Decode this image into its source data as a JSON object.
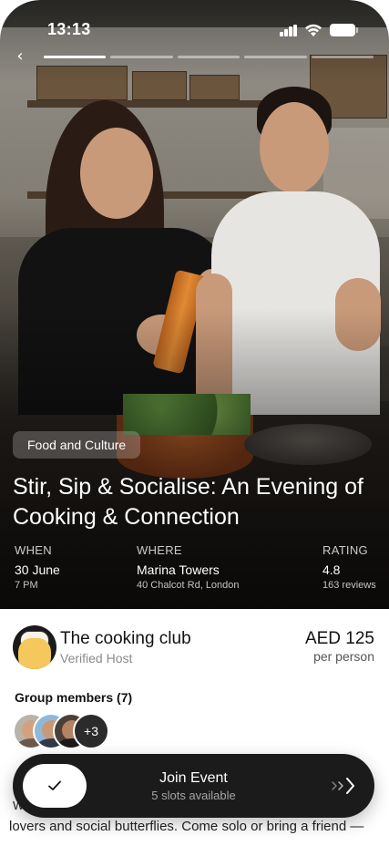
{
  "status_bar": {
    "time": "13:13"
  },
  "story": {
    "segments": 5,
    "active_segment": 1
  },
  "event": {
    "category": "Food and Culture",
    "title": "Stir, Sip & Socialise: An Evening of Cooking & Connection",
    "when": {
      "label": "WHEN",
      "value": "30 June",
      "sub": "7 PM"
    },
    "where": {
      "label": "WHERE",
      "value": "Marina Towers",
      "sub": "40 Chalcot Rd, London"
    },
    "rating": {
      "label": "RATING",
      "value": "4.8",
      "sub": "163 reviews"
    }
  },
  "host": {
    "name": "The cooking club",
    "subtitle": "Verified Host"
  },
  "price": {
    "amount": "AED 125",
    "unit": "per person"
  },
  "members": {
    "label": "Group members (7)",
    "more": "+3"
  },
  "description": {
    "partial_word": "W",
    "visible_line": "lovers and social butterflies. Come solo or bring a friend —"
  },
  "join": {
    "label": "Join Event",
    "sub": "5 slots available"
  },
  "colors": {
    "bar_bg": "#1b1b1b",
    "accent_white": "#ffffff"
  },
  "icons": [
    "back-chevron-icon",
    "signal-icon",
    "wifi-icon",
    "battery-icon",
    "check-icon",
    "double-chevron-right-icon"
  ]
}
